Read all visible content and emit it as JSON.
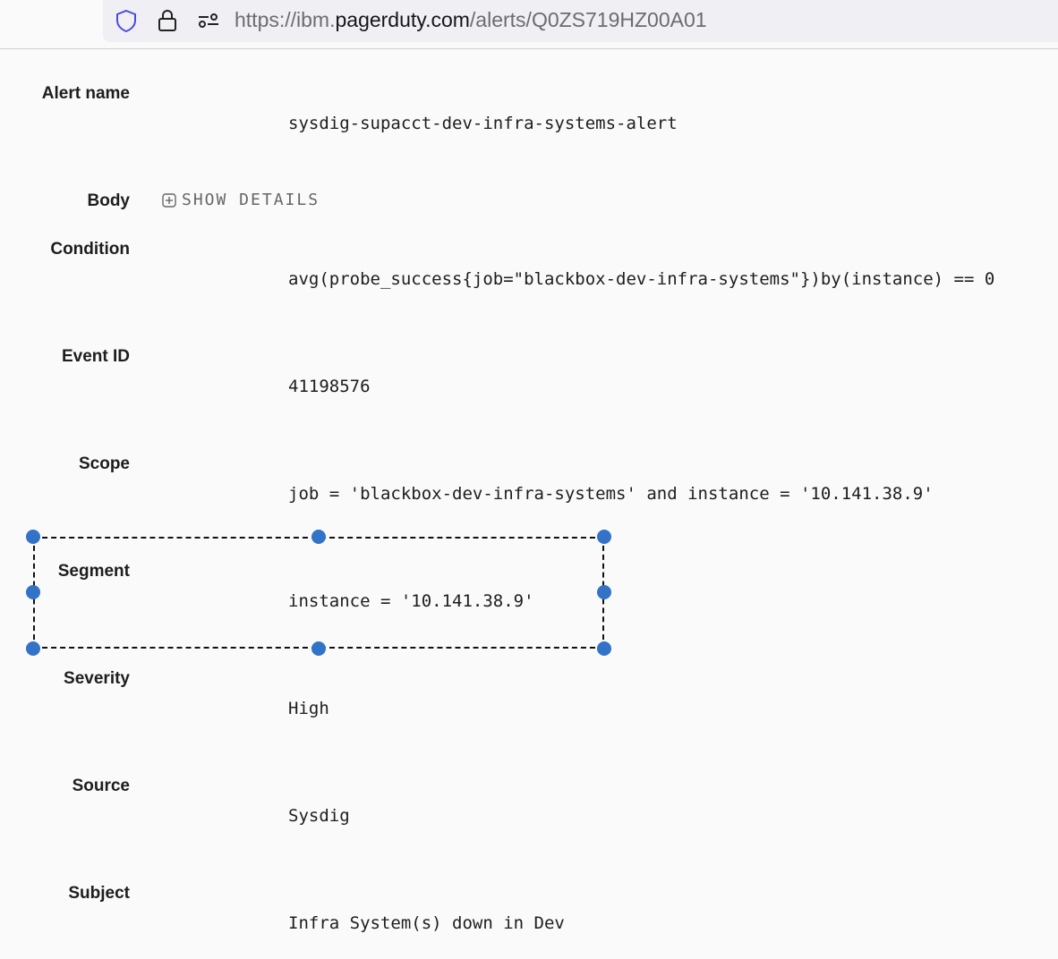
{
  "browser": {
    "url_prefix": "https://ibm.",
    "url_domain": "pagerduty.com",
    "url_path": "/alerts/Q0ZS719HZ00A01",
    "icons": [
      "shield-icon",
      "lock-icon",
      "permissions-icon"
    ]
  },
  "fields": [
    {
      "label": "Alert name",
      "value": "sysdig-supacct-dev-infra-systems-alert"
    },
    {
      "label": "Body",
      "action": "SHOW DETAILS"
    },
    {
      "label": "Condition",
      "value": "avg(probe_success{job=\"blackbox-dev-infra-systems\"})by(instance) == 0"
    },
    {
      "label": "Event ID",
      "value": "41198576"
    },
    {
      "label": "Scope",
      "value": "job = 'blackbox-dev-infra-systems' and instance = '10.141.38.9'"
    },
    {
      "label": "Segment",
      "value": "instance = '10.141.38.9'"
    },
    {
      "label": "Severity",
      "value": "High"
    },
    {
      "label": "Source",
      "value": "Sysdig"
    },
    {
      "label": "Subject",
      "value": "Infra System(s) down in Dev"
    }
  ],
  "colors": {
    "selection_handle": "#3273c8",
    "shield": "#4a4ae0"
  }
}
